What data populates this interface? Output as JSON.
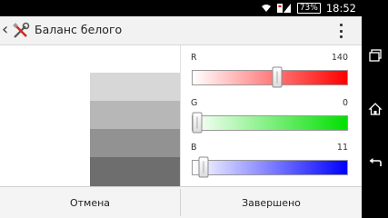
{
  "status_bar": {
    "time": "18:52",
    "battery": "73%",
    "icons": [
      "wifi-icon",
      "signal-icon",
      "battery-icon"
    ]
  },
  "app_bar": {
    "title": "Баланс белого",
    "icons": [
      "back-icon",
      "tools-icon",
      "overflow-menu-icon"
    ]
  },
  "preview": {
    "swatch_colors": [
      "#d7d7d7",
      "#b7b7b7",
      "#929292",
      "#6e6e6e"
    ]
  },
  "channels": [
    {
      "label": "R",
      "value": "140",
      "fraction": 0.549,
      "gradient": [
        "#ffffff",
        "#ff0000"
      ]
    },
    {
      "label": "G",
      "value": "0",
      "fraction": 0.0,
      "gradient": [
        "#ffffff",
        "#00e000"
      ]
    },
    {
      "label": "B",
      "value": "11",
      "fraction": 0.043,
      "gradient": [
        "#ffffff",
        "#0000ff"
      ]
    }
  ],
  "buttons": {
    "cancel": "Отмена",
    "done": "Завершено"
  },
  "nav_bar": {
    "icons": [
      "recent-apps-icon",
      "home-icon",
      "back-nav-icon"
    ]
  }
}
